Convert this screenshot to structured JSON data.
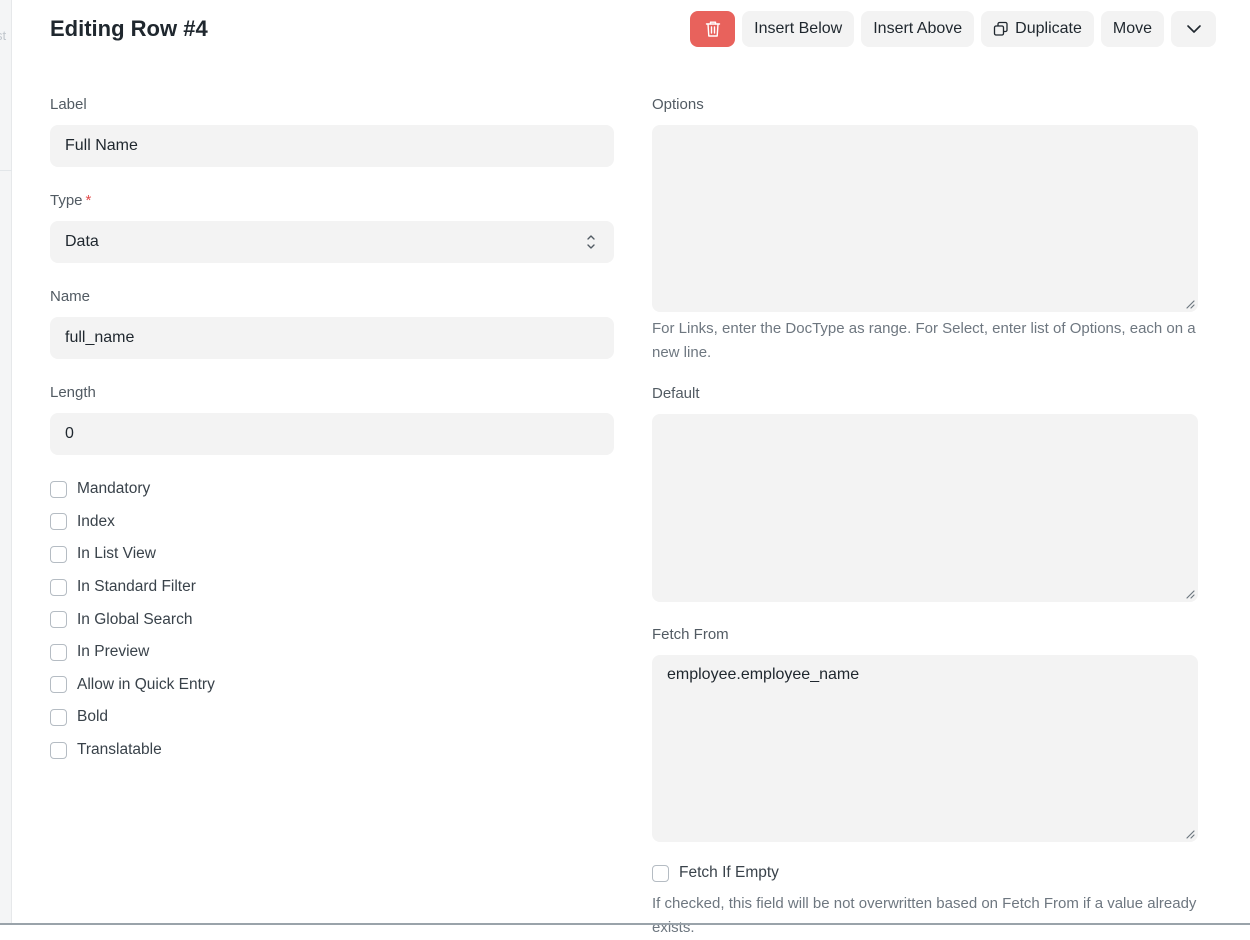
{
  "backdrop": {
    "fragment": "st"
  },
  "header": {
    "title": "Editing Row #4",
    "delete_icon": "trash-icon",
    "insert_below": "Insert Below",
    "insert_above": "Insert Above",
    "duplicate": "Duplicate",
    "duplicate_icon": "duplicate-icon",
    "move": "Move",
    "more_icon": "chevron-down-icon"
  },
  "left": {
    "label": {
      "label": "Label",
      "value": "Full Name"
    },
    "type": {
      "label": "Type",
      "required_mark": "*",
      "value": "Data"
    },
    "name": {
      "label": "Name",
      "value": "full_name"
    },
    "length": {
      "label": "Length",
      "value": "0"
    },
    "checkboxes": [
      "Mandatory",
      "Index",
      "In List View",
      "In Standard Filter",
      "In Global Search",
      "In Preview",
      "Allow in Quick Entry",
      "Bold",
      "Translatable"
    ]
  },
  "right": {
    "options": {
      "label": "Options",
      "value": "",
      "help": "For Links, enter the DocType as range. For Select, enter list of Options, each on a new line."
    },
    "default": {
      "label": "Default",
      "value": ""
    },
    "fetch_from": {
      "label": "Fetch From",
      "value": "employee.employee_name"
    },
    "fetch_if_empty": {
      "label": "Fetch If Empty",
      "help": "If checked, this field will be not overwritten based on Fetch From if a value already exists."
    }
  },
  "colors": {
    "danger": "#e8625c",
    "input_bg": "#f3f3f3",
    "required": "#e24c4c"
  }
}
